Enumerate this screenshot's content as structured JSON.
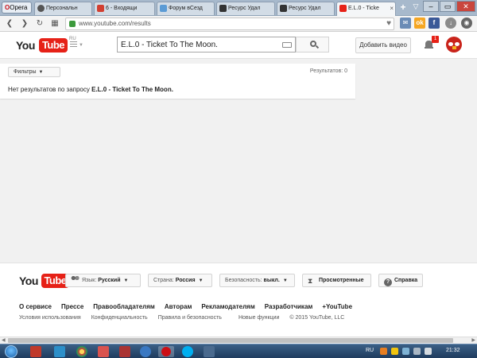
{
  "browser": {
    "menu_label": "Opera",
    "tabs": [
      {
        "label": "Персональн",
        "fav_color": "#555555"
      },
      {
        "label": "6 - Входящи",
        "fav_color": "#d23f31"
      },
      {
        "label": "Форум вСезд",
        "fav_color": "#5b9bd5"
      },
      {
        "label": "Ресурс Удал",
        "fav_color": "#333333"
      },
      {
        "label": "Ресурс Удал",
        "fav_color": "#333333"
      },
      {
        "label": "E.L.0 - Ticke",
        "fav_color": "#e62117"
      }
    ],
    "url": "www.youtube.com/results"
  },
  "masthead": {
    "logo_you": "You",
    "logo_tube": "Tube",
    "logo_region": "RU",
    "search_value": "E.L.0 - Ticket To The Moon.",
    "upload_label": "Добавить видео",
    "notification_count": "1"
  },
  "results": {
    "filters_label": "Фильтры",
    "count_label": "Результатов: 0",
    "no_results_prefix": "Нет результатов по запросу ",
    "no_results_query": "E.L.0 - Ticket To The Moon."
  },
  "footer": {
    "language_label": "Язык: ",
    "language_value": "Русский",
    "country_label": "Страна: ",
    "country_value": "Россия",
    "safety_label": "Безопасность: ",
    "safety_value": "выкл.",
    "history_label": "Просмотренные",
    "help_label": "Справка",
    "links": [
      "О сервисе",
      "Прессе",
      "Правообладателям",
      "Авторам",
      "Рекламодателям",
      "Разработчикам",
      "+YouTube"
    ],
    "secondary_links": [
      "Условия использования",
      "Конфиденциальность",
      "Правила и безопасность",
      "Новые функции",
      "© 2015 YouTube, LLC"
    ]
  },
  "taskbar": {
    "language": "RU",
    "time": "21:32"
  },
  "colors": {
    "youtube_red": "#e62117",
    "taskbar": "#2a4a6e"
  }
}
